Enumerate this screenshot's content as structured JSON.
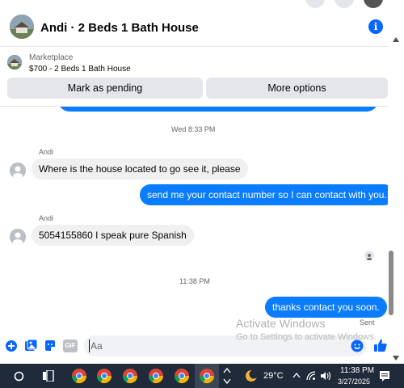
{
  "header": {
    "title": "Andi · 2 Beds 1 Bath House"
  },
  "marketplace": {
    "label": "Marketplace",
    "listing": "$700 - 2 Beds 1 Bath House",
    "pending_label": "Mark as pending",
    "more_label": "More options"
  },
  "messages": {
    "time_1": "Wed 8:33 PM",
    "sender_1": "Andi",
    "msg_1": "Where is the house located to go see it, please",
    "msg_2": "send me your contact number so I can contact with you.",
    "sender_2": "Andi",
    "msg_3": "5054155860 I speak pure Spanish",
    "time_2": "11:38 PM",
    "msg_4": "thanks contact you soon.",
    "sent_label": "Sent"
  },
  "composer": {
    "placeholder": "Aa"
  },
  "watermark": {
    "title": "Activate Windows",
    "subtitle": "Go to Settings to activate Windows."
  },
  "taskbar": {
    "temperature": "29°C",
    "time": "11:38 PM",
    "date": "3/27/2025",
    "gif_label": "GIF"
  },
  "colors": {
    "accent": "#0866ff",
    "outgoing_bubble": "#0a7cff",
    "incoming_bubble": "#f0f0f0",
    "taskbar": "#1f2a3a"
  }
}
